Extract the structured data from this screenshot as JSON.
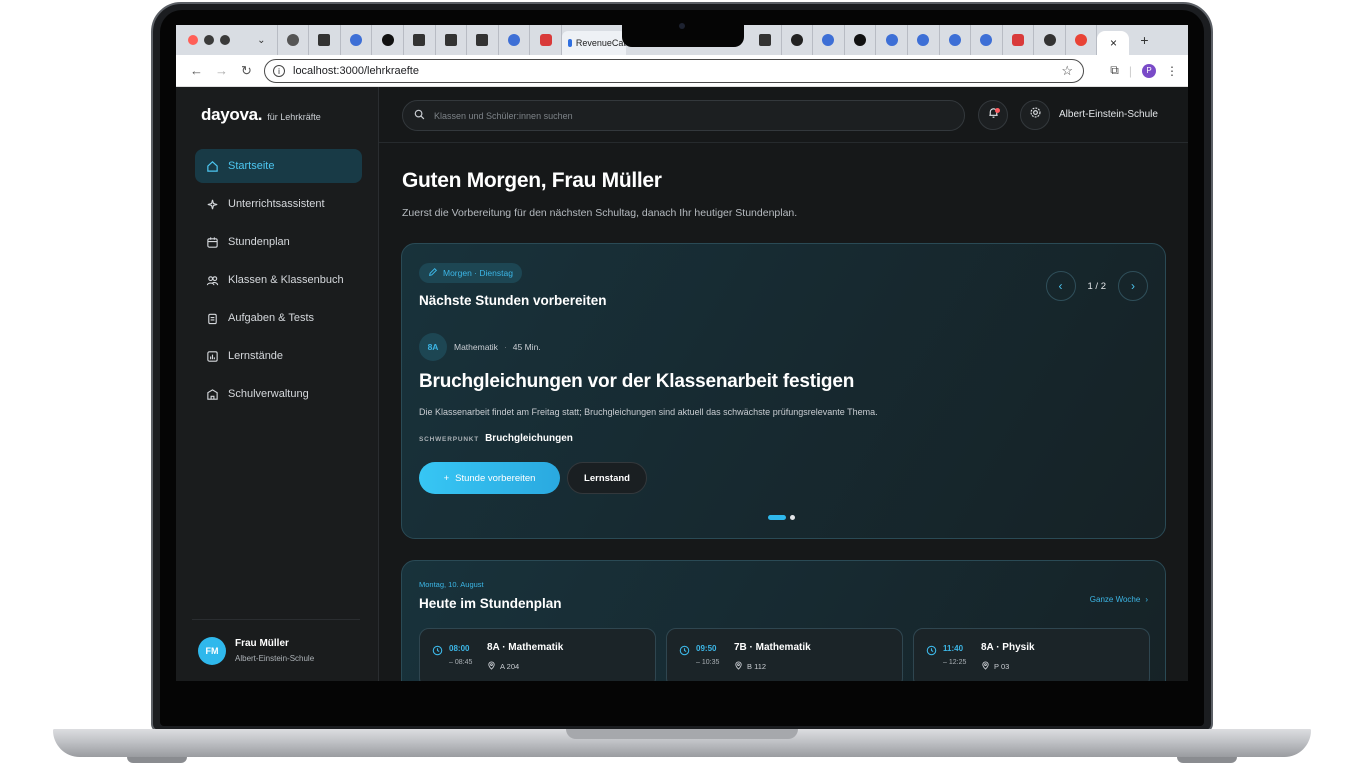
{
  "browser": {
    "url": "localhost:3000/lehrkraefte",
    "tab_label": "RevenueCat",
    "active_tab_close": "×",
    "new_tab": "+"
  },
  "sidebar": {
    "brand_name": "dayova.",
    "brand_sub": "für Lehrkräfte",
    "items": [
      {
        "label": "Startseite",
        "icon": "home-icon"
      },
      {
        "label": "Unterrichtsassistent",
        "icon": "sparkle-icon"
      },
      {
        "label": "Stundenplan",
        "icon": "calendar-icon"
      },
      {
        "label": "Klassen & Klassenbuch",
        "icon": "users-icon"
      },
      {
        "label": "Aufgaben & Tests",
        "icon": "clipboard-icon"
      },
      {
        "label": "Lernstände",
        "icon": "chart-icon"
      },
      {
        "label": "Schulverwaltung",
        "icon": "building-icon"
      }
    ],
    "user": {
      "initials": "FM",
      "name": "Frau Müller",
      "school": "Albert-Einstein-Schule"
    }
  },
  "topbar": {
    "search_placeholder": "Klassen und Schüler:innen suchen",
    "school": "Albert-Einstein-Schule"
  },
  "main": {
    "greeting": "Guten Morgen, Frau Müller",
    "subtitle": "Zuerst die Vorbereitung für den nächsten Schultag, danach Ihr heutiger Stundenplan."
  },
  "next_lessons": {
    "pill": "Morgen · Dienstag",
    "title": "Nächste Stunden vorbereiten",
    "pager": "1 / 2",
    "class": "8A",
    "subject": "Mathematik",
    "sep": "·",
    "duration": "45 Min.",
    "lesson_title": "Bruchgleichungen vor der Klassenarbeit festigen",
    "description": "Die Klassenarbeit findet am Freitag statt; Bruchgleichungen sind aktuell das schwächste prüfungsrelevante Thema.",
    "focus_label": "SCHWERPUNKT",
    "focus_value": "Bruchgleichungen",
    "primary_button": "Stunde vorbereiten",
    "secondary_button": "Lernstand"
  },
  "schedule": {
    "date": "Montag, 10. August",
    "title": "Heute im Stundenplan",
    "week_link": "Ganze Woche",
    "slots": [
      {
        "start": "08:00",
        "end": "– 08:45",
        "title": "8A · Mathematik",
        "room": "A 204"
      },
      {
        "start": "09:50",
        "end": "– 10:35",
        "title": "7B · Mathematik",
        "room": "B 112"
      },
      {
        "start": "11:40",
        "end": "– 12:25",
        "title": "8A · Physik",
        "room": "P 03"
      }
    ]
  },
  "colors": {
    "accent": "#2fb8ec",
    "background": "#161819",
    "card": "#18323b"
  }
}
